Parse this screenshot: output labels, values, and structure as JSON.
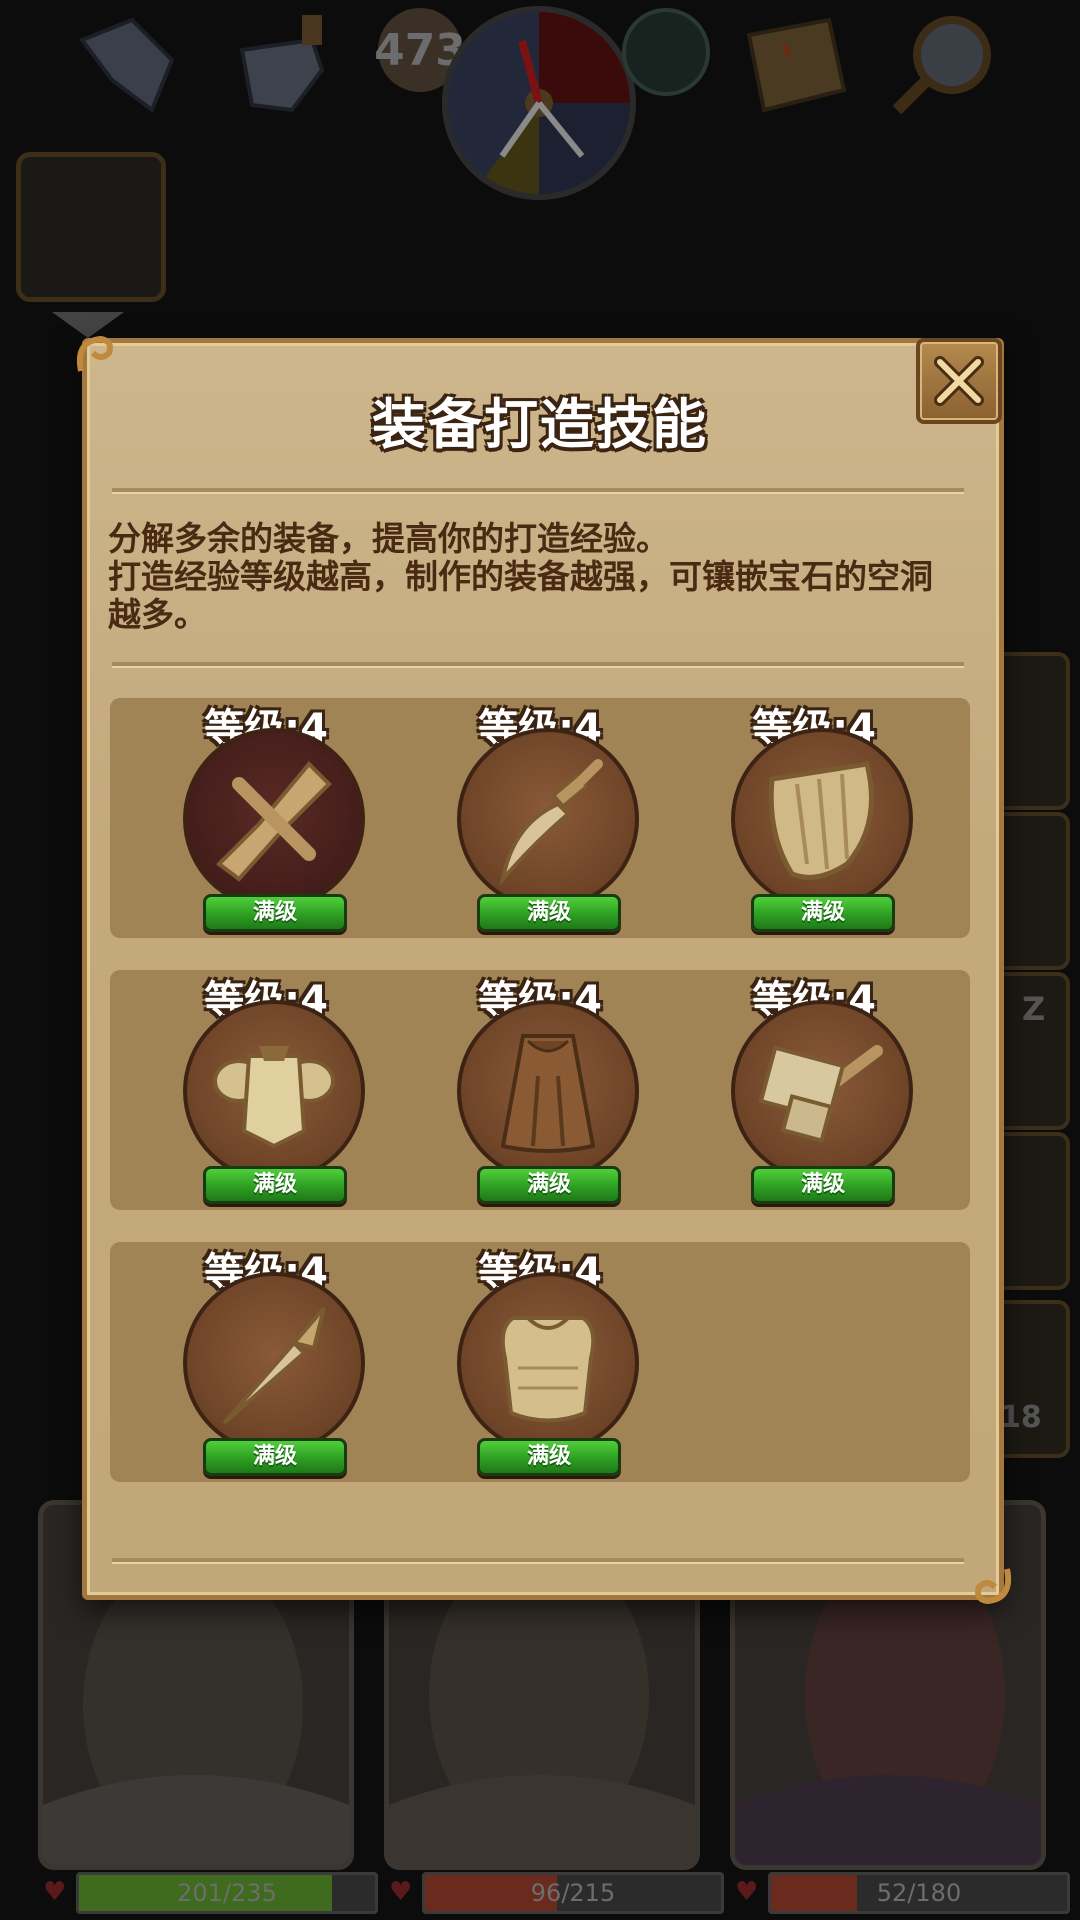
{
  "topbar": {
    "counter_value": "473"
  },
  "modal": {
    "title": "装备打造技能",
    "description_lines": [
      "分解多余的装备，提高你的打造经验。",
      "打造经验等级越高，制作的装备越强，可镶嵌宝石的空洞",
      "越多。"
    ],
    "skills": [
      {
        "name": "crossbow-icon",
        "level_text": "等级:4",
        "status": "满级"
      },
      {
        "name": "dagger-icon",
        "level_text": "等级:4",
        "status": "满级"
      },
      {
        "name": "shield-icon",
        "level_text": "等级:4",
        "status": "满级"
      },
      {
        "name": "plate-armor-icon",
        "level_text": "等级:4",
        "status": "满级"
      },
      {
        "name": "cloak-icon",
        "level_text": "等级:4",
        "status": "满级"
      },
      {
        "name": "hammer-icon",
        "level_text": "等级:4",
        "status": "满级"
      },
      {
        "name": "spear-tip-icon",
        "level_text": "等级:4",
        "status": "满级"
      },
      {
        "name": "chest-armor-icon",
        "level_text": "等级:4",
        "status": "满级"
      }
    ]
  },
  "heroes": [
    {
      "hp": "201/235",
      "hp_fraction": 0.855,
      "bar_color": "#3e6b1e"
    },
    {
      "hp": "96/215",
      "hp_fraction": 0.447,
      "bar_color": "#6b2a1e"
    },
    {
      "hp": "52/180",
      "hp_fraction": 0.289,
      "bar_color": "#6b2a1e"
    }
  ],
  "side_labels": {
    "zz": "Z",
    "count": "18"
  },
  "colors": {
    "panel": "#c3a97c",
    "row_panel": "#a08456",
    "max_badge_green": "#2c9a22",
    "title_outline": "#3b2412"
  }
}
